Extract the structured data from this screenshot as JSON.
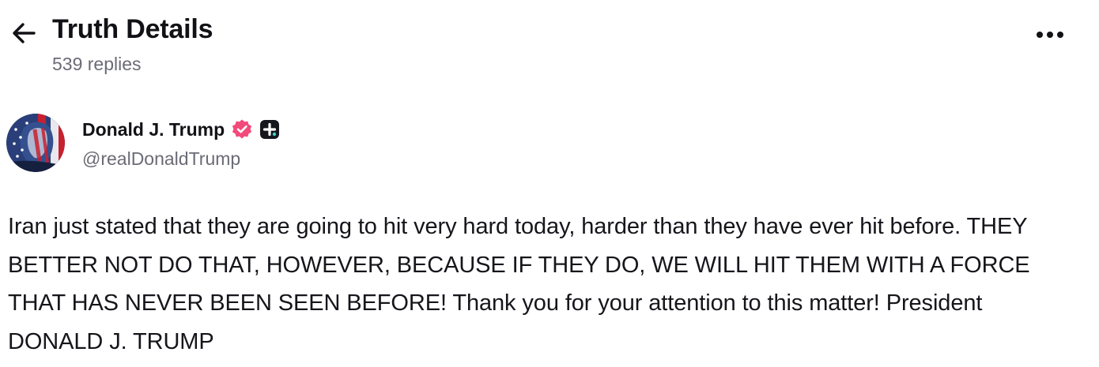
{
  "header": {
    "title": "Truth Details",
    "replies": "539 replies",
    "back_icon": "arrow-left-icon",
    "more_icon": "more-horizontal-icon"
  },
  "author": {
    "display_name": "Donald J. Trump",
    "handle": "@realDonaldTrump",
    "verified_icon": "verified-badge-icon",
    "plus_icon": "plus-badge-icon",
    "avatar_icon": "avatar-image"
  },
  "post": {
    "text": "Iran just stated that they are going to hit very hard today, harder than they have ever hit before. THEY BETTER NOT DO THAT, HOWEVER, BECAUSE IF THEY DO, WE WILL HIT THEM WITH A FORCE THAT HAS NEVER BEEN SEEN BEFORE! Thank you for your attention to this matter! President DONALD J. TRUMP"
  },
  "colors": {
    "text_primary": "#111116",
    "text_secondary": "#6b6b76",
    "verified_badge": "#f24a7a",
    "plus_badge": "#16161d",
    "background": "#ffffff"
  }
}
